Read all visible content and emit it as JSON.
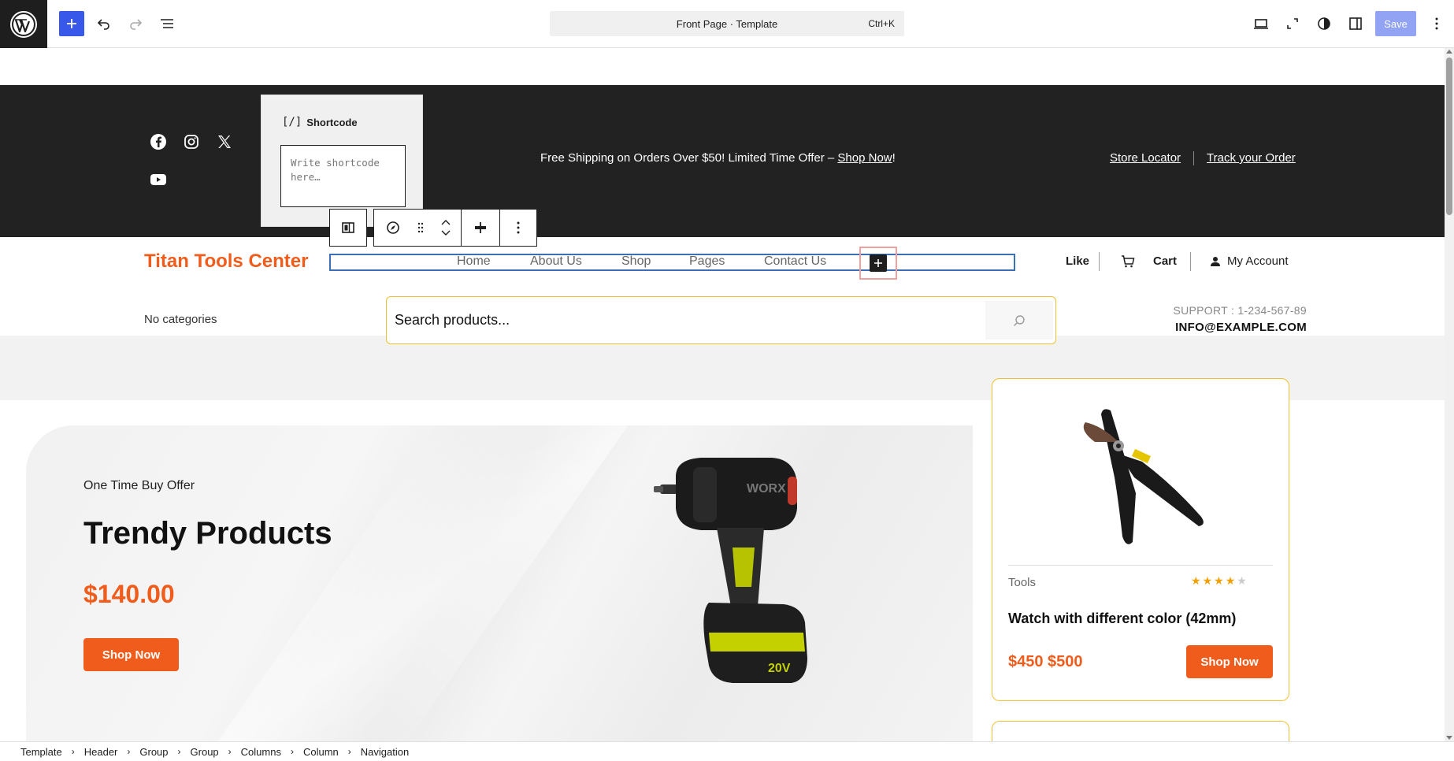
{
  "editor": {
    "command_label": "Front Page · Template",
    "command_shortcut": "Ctrl+K",
    "save_label": "Save"
  },
  "topbar": {
    "shipping_text": "Free Shipping on Orders Over $50! Limited Time Offer – ",
    "shipping_link": "Shop Now",
    "shipping_end": "!",
    "store_locator": "Store Locator",
    "track_order": "Track your Order",
    "social_icons": [
      "facebook-icon",
      "instagram-icon",
      "x-icon",
      "youtube-icon"
    ]
  },
  "shortcode": {
    "title": "Shortcode",
    "icon_glyph": "[/]",
    "placeholder": "Write shortcode here…"
  },
  "header": {
    "site_title": "Titan Tools Center",
    "nav": [
      "Home",
      "About Us",
      "Shop",
      "Pages",
      "Contact Us"
    ],
    "like": "Like",
    "cart": "Cart",
    "account": "My Account"
  },
  "search_row": {
    "categories": "No categories",
    "search_text": "Search products...",
    "support": "SUPPORT : 1-234-567-89",
    "email": "INFO@EXAMPLE.COM"
  },
  "hero": {
    "offer": "One Time Buy Offer",
    "title": "Trendy Products",
    "price": "$140.00",
    "button": "Shop Now"
  },
  "product_card": {
    "category": "Tools",
    "rating": 4,
    "rating_max": 5,
    "name": "Watch with different color (42mm)",
    "price": "$450 $500",
    "button": "Shop Now"
  },
  "breadcrumb": [
    "Template",
    "Header",
    "Group",
    "Group",
    "Columns",
    "Column",
    "Navigation"
  ],
  "colors": {
    "accent": "#f05c1b",
    "wp_blue": "#3858e9",
    "dark_bar": "#222222",
    "card_border": "#f0c030"
  }
}
